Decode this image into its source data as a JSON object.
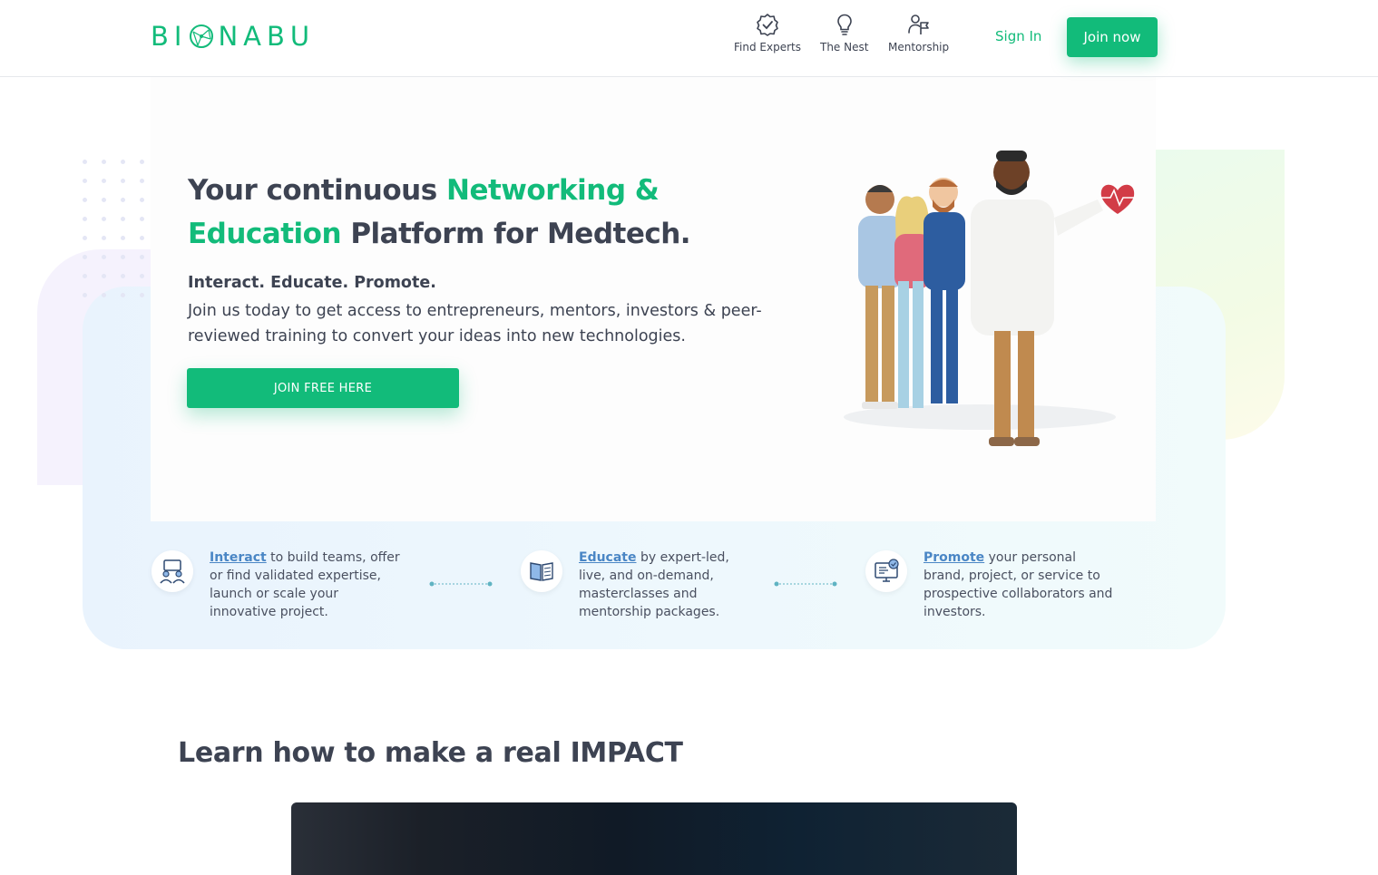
{
  "header": {
    "logo_text_left": "BI",
    "logo_text_right": "NABU",
    "nav": [
      {
        "label": "Find Experts",
        "icon": "badge-check-icon"
      },
      {
        "label": "The Nest",
        "icon": "lightbulb-icon"
      },
      {
        "label": "Mentorship",
        "icon": "mentor-flag-icon"
      }
    ],
    "sign_in": "Sign In",
    "join_now": "Join now"
  },
  "hero": {
    "title_part1": "Your continuous ",
    "title_accent": "Networking & Education",
    "title_part2": " Platform for Medtech.",
    "tagline": "Interact. Educate. Promote.",
    "description": "Join us today to get access to entrepreneurs, mentors, investors & peer-reviewed training to convert your ideas into new technologies.",
    "cta": "JOIN FREE HERE"
  },
  "features": [
    {
      "link": "Interact",
      "text": " to build teams, offer or find validated expertise, launch or scale your innovative project.",
      "icon": "team-meeting-icon"
    },
    {
      "link": "Educate",
      "text": " by expert-led, live, and on-demand, masterclasses and mentorship packages.",
      "icon": "open-book-icon"
    },
    {
      "link": "Promote",
      "text": " your personal brand, project, or service to prospective collaborators and investors.",
      "icon": "monitor-promote-icon"
    }
  ],
  "learn": {
    "title": "Learn how to make a real IMPACT"
  },
  "colors": {
    "brand_green": "#12bb7a",
    "text_dark": "#3d4352",
    "link_blue": "#4a86c5"
  }
}
